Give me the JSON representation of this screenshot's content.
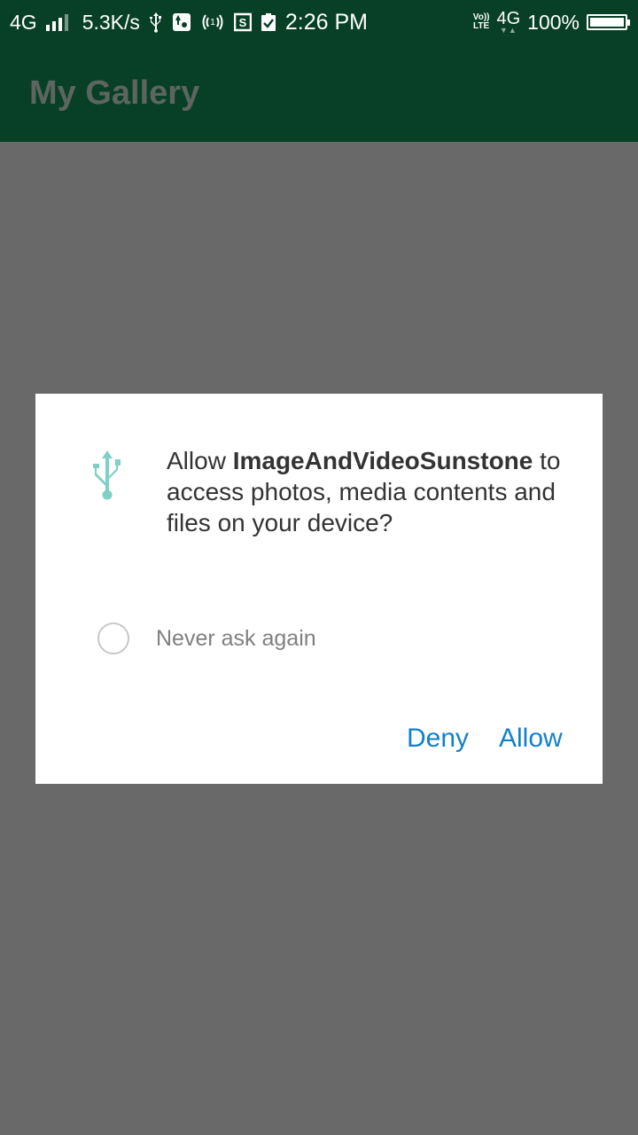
{
  "status_bar": {
    "network": "4G",
    "speed": "5.3K/s",
    "time": "2:26 PM",
    "volte_top": "Vo))",
    "volte_bottom": "LTE",
    "network_right": "4G",
    "battery_percent": "100%",
    "battery_level": 1.0,
    "icons": [
      "usb-icon",
      "usb-debug-icon",
      "hotspot-icon",
      "s-app-icon",
      "clipboard-check-icon"
    ]
  },
  "app_bar": {
    "title": "My Gallery"
  },
  "dialog": {
    "icon": "usb-icon",
    "message_prefix": "Allow ",
    "app_name": "ImageAndVideoSunstone",
    "message_suffix": " to access photos, media contents and files on your device?",
    "never_ask_label": "Never ask again",
    "never_ask_checked": false,
    "deny_label": "Deny",
    "allow_label": "Allow",
    "accent_color": "#1281c9",
    "icon_color": "#7fd0c4"
  },
  "colors": {
    "app_bar": "#084027",
    "scrim": "#696969"
  }
}
